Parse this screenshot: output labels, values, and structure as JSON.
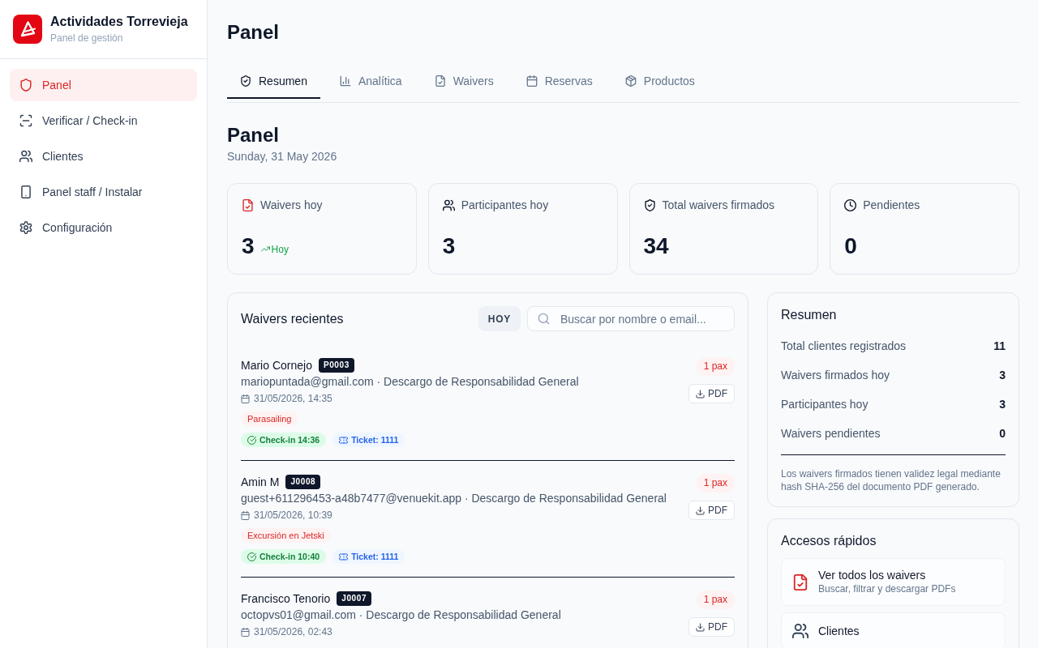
{
  "sidebar": {
    "brand": {
      "title": "Actividades Torrevieja",
      "subtitle": "Panel de gestión"
    },
    "items": [
      {
        "label": "Panel",
        "selected": true
      },
      {
        "label": "Verificar / Check-in",
        "selected": false
      },
      {
        "label": "Clientes",
        "selected": false
      },
      {
        "label": "Panel staff / Instalar",
        "selected": false
      },
      {
        "label": "Configuración",
        "selected": false
      }
    ]
  },
  "page_title": "Panel",
  "tabs": [
    {
      "label": "Resumen",
      "selected": true
    },
    {
      "label": "Analítica",
      "selected": false
    },
    {
      "label": "Waivers",
      "selected": false
    },
    {
      "label": "Reservas",
      "selected": false
    },
    {
      "label": "Productos",
      "selected": false
    }
  ],
  "heading": {
    "title": "Panel",
    "date": "Sunday, 31 May 2026"
  },
  "stats": [
    {
      "label": "Waivers hoy",
      "value": "3",
      "trend": "Hoy"
    },
    {
      "label": "Participantes hoy",
      "value": "3"
    },
    {
      "label": "Total waivers firmados",
      "value": "34"
    },
    {
      "label": "Pendientes",
      "value": "0"
    }
  ],
  "recent_waivers": {
    "title": "Waivers recientes",
    "filter_button": "HOY",
    "search": {
      "placeholder": "Buscar por nombre o email..."
    },
    "rows": [
      {
        "name": "Mario Cornejo",
        "code": "P0003",
        "details": "mariopuntada@gmail.com · Descargo de Responsabilidad General",
        "date": "31/05/2026, 14:35",
        "activity": "Parasailing",
        "checkin": "Check-in 14:36",
        "ticket": "Ticket: 1111",
        "pax": "1 pax",
        "pdf_button": "PDF"
      },
      {
        "name": "Amin M",
        "code": "J0008",
        "details": "guest+611296453-a48b7477@venuekit.app · Descargo de Responsabilidad General",
        "date": "31/05/2026, 10:39",
        "activity": "Excursión en Jetski",
        "checkin": "Check-in 10:40",
        "ticket": "Ticket: 1111",
        "pax": "1 pax",
        "pdf_button": "PDF"
      },
      {
        "name": "Francisco Tenorio",
        "code": "J0007",
        "details": "octopvs01@gmail.com · Descargo de Responsabilidad General",
        "date": "31/05/2026, 02:43",
        "pax": "1 pax",
        "pdf_button": "PDF"
      }
    ]
  },
  "summary": {
    "title": "Resumen",
    "rows": [
      {
        "label": "Total clientes registrados",
        "value": "11"
      },
      {
        "label": "Waivers firmados hoy",
        "value": "3"
      },
      {
        "label": "Participantes hoy",
        "value": "3"
      },
      {
        "label": "Waivers pendientes",
        "value": "0"
      }
    ],
    "note": "Los waivers firmados tienen validez legal mediante hash SHA-256 del documento PDF generado."
  },
  "quick_access": {
    "title": "Accesos rápidos",
    "items": [
      {
        "title": "Ver todos los waivers",
        "subtitle": "Buscar, filtrar y descargar PDFs"
      },
      {
        "title": "Clientes"
      }
    ]
  }
}
